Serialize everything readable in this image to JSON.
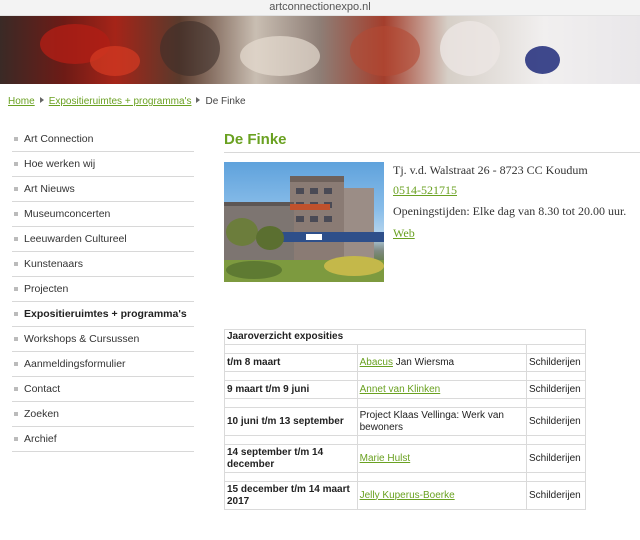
{
  "browser": {
    "url": "artconnectionexpo.nl"
  },
  "breadcrumb": {
    "home": "Home",
    "section": "Expositieruimtes + programma's",
    "current": "De Finke"
  },
  "sidebar": {
    "items": [
      {
        "label": "Art Connection",
        "active": false
      },
      {
        "label": "Hoe werken wij",
        "active": false
      },
      {
        "label": "Art Nieuws",
        "active": false
      },
      {
        "label": "Museumconcerten",
        "active": false
      },
      {
        "label": "Leeuwarden Cultureel",
        "active": false
      },
      {
        "label": "Kunstenaars",
        "active": false
      },
      {
        "label": "Projecten",
        "active": false
      },
      {
        "label": "Expositieruimtes + programma's",
        "active": true
      },
      {
        "label": "Workshops & Cursussen",
        "active": false
      },
      {
        "label": "Aanmeldingsformulier",
        "active": false
      },
      {
        "label": "Contact",
        "active": false
      },
      {
        "label": "Zoeken",
        "active": false
      },
      {
        "label": "Archief",
        "active": false
      }
    ]
  },
  "main": {
    "title": "De Finke",
    "address": "Tj. v.d. Walstraat 26 - 8723 CC Koudum",
    "phone": "0514-521715",
    "hours": "Openingstijden: Elke dag van 8.30 tot 20.00 uur.",
    "web": "Web"
  },
  "table": {
    "header": "Jaaroverzicht exposities",
    "rows": [
      {
        "date": "t/m 8 maart",
        "link": "Abacus",
        "artist": " Jan Wiersma",
        "type": "Schilderijen"
      },
      {
        "date": "9 maart t/m 9 juni",
        "link": "Annet van Klinken",
        "artist": "",
        "type": "Schilderijen"
      },
      {
        "date": "10 juni t/m 13 september",
        "link": "",
        "artist": "Project Klaas Vellinga: Werk van bewoners",
        "type": "Schilderijen"
      },
      {
        "date": "14 september t/m 14 december",
        "link": "Marie Hulst",
        "artist": "",
        "type": "Schilderijen"
      },
      {
        "date": "15 december t/m 14 maart 2017",
        "link": "Jelly Kuperus-Boerke",
        "artist": "",
        "type": " Schilderijen"
      }
    ]
  },
  "colors": {
    "accent": "#6aa121",
    "rule": "#d8d8d8"
  }
}
